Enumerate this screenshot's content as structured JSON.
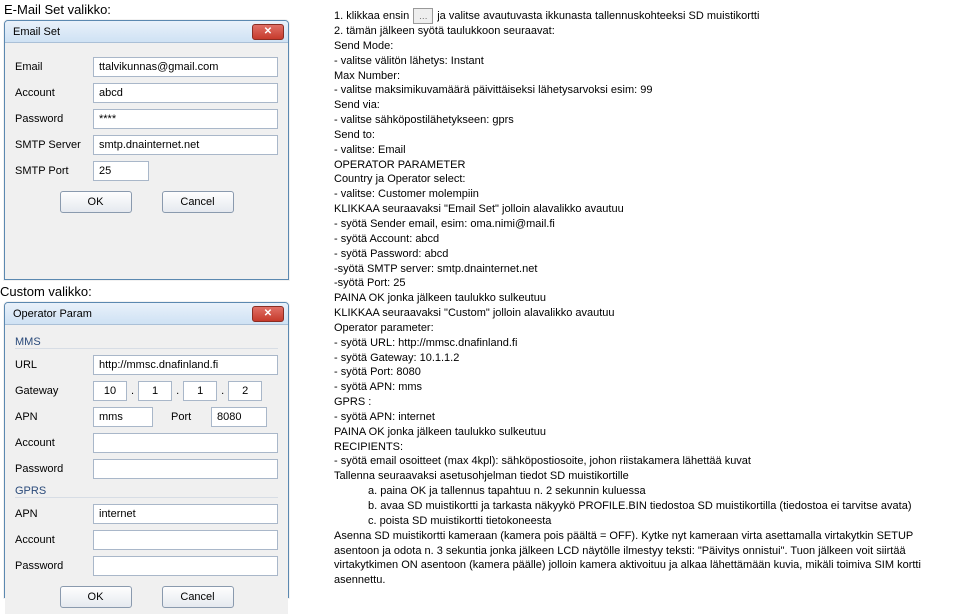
{
  "labels": {
    "email_label": "E-Mail Set valikko:",
    "custom_label": "Custom valikko:"
  },
  "email_dialog": {
    "title": "Email Set",
    "rows": {
      "email_lbl": "Email",
      "email_val": "ttalvikunnas@gmail.com",
      "account_lbl": "Account",
      "account_val": "abcd",
      "password_lbl": "Password",
      "password_val": "****",
      "smtp_lbl": "SMTP Server",
      "smtp_val": "smtp.dnainternet.net",
      "port_lbl": "SMTP Port",
      "port_val": "25"
    },
    "ok": "OK",
    "cancel": "Cancel"
  },
  "custom_dialog": {
    "title": "Operator Param",
    "mms_hdr": "MMS",
    "gprs_hdr": "GPRS",
    "rows": {
      "url_lbl": "URL",
      "url_val": "http://mmsc.dnafinland.fi",
      "gateway_lbl": "Gateway",
      "gw1": "10",
      "gw2": "1",
      "gw3": "1",
      "gw4": "2",
      "apn_lbl": "APN",
      "apn_val": "mms",
      "port_lbl": "Port",
      "port_val": "8080",
      "acct_lbl": "Account",
      "acct_val": "",
      "pwd_lbl": "Password",
      "pwd_val": "",
      "gprs_apn_lbl": "APN",
      "gprs_apn_val": "internet",
      "gprs_acct_lbl": "Account",
      "gprs_acct_val": "",
      "gprs_pwd_lbl": "Password",
      "gprs_pwd_val": ""
    },
    "ok": "OK",
    "cancel": "Cancel"
  },
  "instr": {
    "l1a": "1.   klikkaa ensin",
    "l1b": "ja valitse avautuvasta ikkunasta tallennuskohteeksi SD muistikortti",
    "l2": "2.   tämän jälkeen syötä taulukkoon seuraavat:",
    "l3": "Send Mode:",
    "l4": " - valitse välitön lähetys: Instant",
    "l5": "Max Number:",
    "l6": " - valitse maksimikuvamäärä päivittäiseksi lähetysarvoksi esim: 99",
    "l7": "Send via:",
    "l8": " - valitse sähköpostilähetykseen: gprs",
    "l9": "Send to:",
    "l10": " - valitse: Email",
    "l11": "OPERATOR PARAMETER",
    "l12": "Country ja Operator select:",
    "l13": " - valitse: Customer molempiin",
    "l14": "KLIKKAA seuraavaksi \"Email Set\" jolloin alavalikko avautuu",
    "l15": " - syötä Sender email, esim: oma.nimi@mail.fi",
    "l16": " - syötä Account: abcd",
    "l17": "  - syötä Password: abcd",
    "l18": "-syötä SMTP server: smtp.dnainternet.net",
    "l19": "-syötä Port: 25",
    "l20": "PAINA OK jonka jälkeen taulukko sulkeutuu",
    "l21": "KLIKKAA seuraavaksi \"Custom\" jolloin alavalikko avautuu",
    "l22": "Operator parameter:",
    "l23": "  - syötä URL: http://mmsc.dnafinland.fi",
    "l24": " - syötä Gateway: 10.1.1.2",
    "l25": " - syötä Port: 8080",
    "l26": " - syötä APN: mms",
    "l27": "GPRS :",
    "l28": " - syötä APN: internet",
    "l29": "PAINA OK jonka jälkeen taulukko sulkeutuu",
    "l30": "RECIPIENTS:",
    "l31": "  - syötä email osoitteet (max 4kpl): sähköpostiosoite, johon riistakamera lähettää kuvat",
    "l32": "Tallenna seuraavaksi asetusohjelman tiedot SD muistikortille",
    "l33": "a.  paina OK ja tallennus tapahtuu n. 2 sekunnin kuluessa",
    "l34": "b.  avaa SD muistikortti ja tarkasta näkyykö PROFILE.BIN tiedostoa SD muistikortilla (tiedostoa ei tarvitse avata)",
    "l35": "c.  poista SD muistikortti tietokoneesta",
    "l36": "Asenna SD muistikortti kameraan (kamera pois päältä = OFF). Kytke nyt kameraan virta asettamalla virtakytkin SETUP asentoon ja odota n. 3 sekuntia jonka jälkeen LCD näytölle ilmestyy teksti: \"Päivitys onnistui\". Tuon jälkeen voit siirtää virtakytkimen ON asentoon (kamera päälle) jolloin kamera aktivoituu ja alkaa lähettämään kuvia, mikäli toimiva SIM kortti asennettu."
  }
}
